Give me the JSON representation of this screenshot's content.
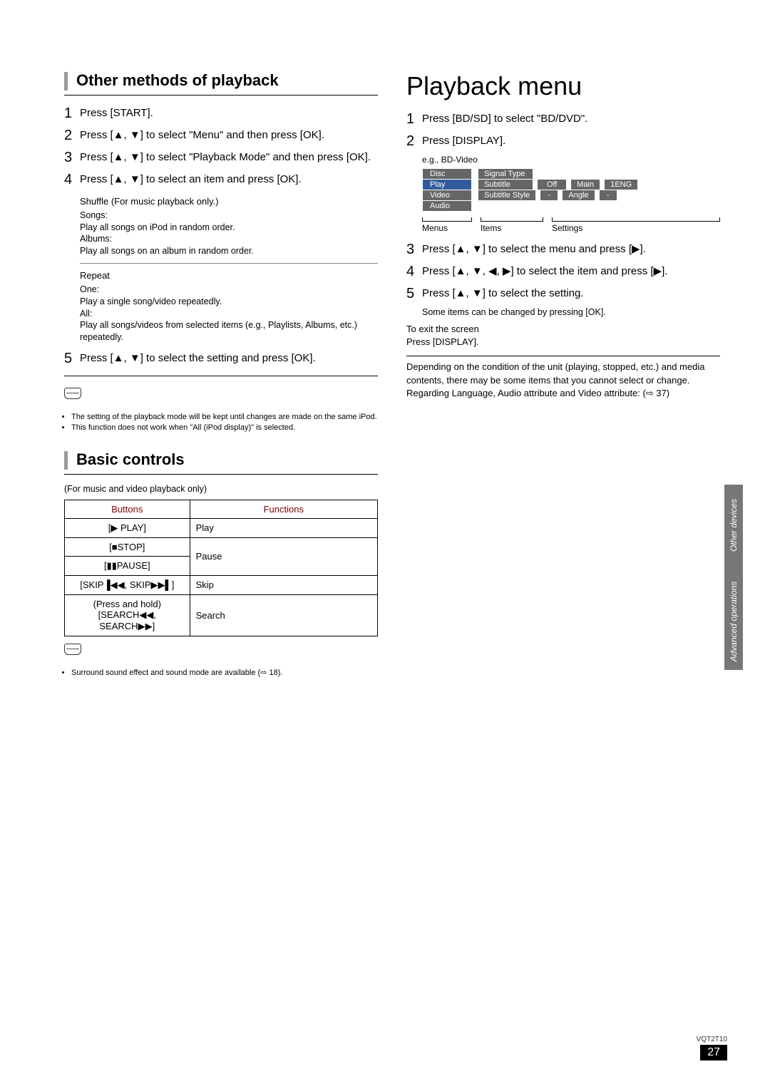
{
  "left": {
    "section1_title": "Other methods of playback",
    "steps1": [
      "Press [START].",
      "Press [▲, ▼] to select \"Menu\" and then press [OK].",
      "Press [▲, ▼] to select \"Playback Mode\" and then press [OK].",
      "Press [▲, ▼] to select an item and press [OK]."
    ],
    "shuffle": {
      "title": "Shuffle (For music playback only.)",
      "songs_label": "Songs:",
      "songs_desc": "Play all songs on iPod in random order.",
      "albums_label": "Albums:",
      "albums_desc": "Play all songs on an album in random order."
    },
    "repeat": {
      "title": "Repeat",
      "one_label": "One:",
      "one_desc": "Play a single song/video repeatedly.",
      "all_label": "All:",
      "all_desc": "Play all songs/videos from selected items (e.g., Playlists, Albums, etc.) repeatedly."
    },
    "step5": "Press [▲, ▼] to select the setting and press [OK].",
    "notes1": [
      "The setting of the playback mode will be kept until changes are made on the same iPod.",
      "This function does not work when \"All (iPod display)\" is selected."
    ],
    "section2_title": "Basic controls",
    "table_caption": "(For music and video playback only)",
    "table": {
      "headers": [
        "Buttons",
        "Functions"
      ],
      "rows": [
        [
          "[▶ PLAY]",
          "Play"
        ],
        [
          "[■STOP]",
          "Pause"
        ],
        [
          "[▮▮PAUSE]",
          ""
        ],
        [
          "[SKIP▐◀◀, SKIP▶▶▌]",
          "Skip"
        ],
        [
          "(Press and hold) [SEARCH◀◀, SEARCH▶▶]",
          "Search"
        ]
      ]
    },
    "notes2": [
      "Surround sound effect and sound mode are available (⇨ 18)."
    ]
  },
  "right": {
    "title": "Playback menu",
    "steps_a": [
      "Press [BD/SD] to select \"BD/DVD\".",
      "Press [DISPLAY]."
    ],
    "eg": "e.g., BD-Video",
    "osd": {
      "menus": [
        "Disc",
        "Play",
        "Video",
        "Audio"
      ],
      "items": [
        {
          "label": "Signal Type",
          "vals": []
        },
        {
          "label": "Subtitle",
          "vals": [
            "Off",
            "Main",
            "1ENG"
          ]
        },
        {
          "label": "Subtitle Style",
          "vals": [
            "-",
            "Angle",
            "-"
          ]
        }
      ],
      "col_labels": [
        "Menus",
        "Items",
        "Settings"
      ]
    },
    "steps_b": [
      "Press [▲, ▼] to select the menu and press [▶].",
      "Press [▲, ▼, ◀, ▶] to select the item and press [▶].",
      "Press [▲, ▼] to select the setting."
    ],
    "step5_sub": "Some items can be changed by pressing [OK].",
    "exit_title": "To exit the screen",
    "exit_text": "Press [DISPLAY].",
    "para1": "Depending on the condition of the unit (playing, stopped, etc.) and media contents, there may be some items that you cannot select or change.",
    "para2": "Regarding Language, Audio attribute and Video attribute: (⇨ 37)"
  },
  "side": {
    "t1": "Other devices",
    "t2": "Advanced operations"
  },
  "footer": {
    "code": "VQT2T10",
    "page": "27"
  }
}
